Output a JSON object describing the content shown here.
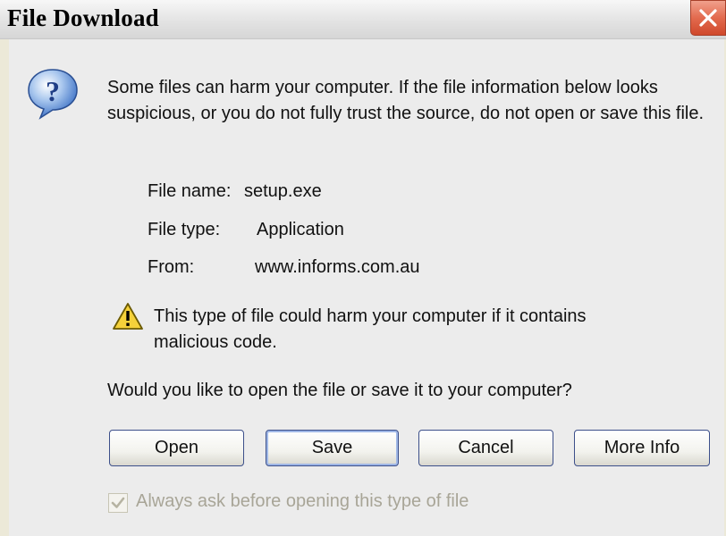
{
  "window": {
    "title": "File Download",
    "close_glyph": "✕"
  },
  "warning": {
    "text": "Some files can harm your computer. If the file information below looks suspicious, or you do not fully trust the source, do not open or save this file."
  },
  "file_info": {
    "name_label": "File name:",
    "name_value": "setup.exe",
    "type_label": "File type:",
    "type_value": "Application",
    "from_label": "From:",
    "from_value": "www.informs.com.au"
  },
  "harm_warning": {
    "text": "This type of file could harm your computer if it contains malicious code."
  },
  "question": "Would you like to open the file or save it to your computer?",
  "buttons": {
    "open": "Open",
    "save": "Save",
    "cancel": "Cancel",
    "more_info": "More Info"
  },
  "checkbox": {
    "label": "Always ask before opening this type of file",
    "checked": true,
    "disabled": true
  },
  "colors": {
    "dialog_bg": "#ececec",
    "close_button": "#e36a4e",
    "button_border": "#3c4f8a",
    "disabled_text": "#a8a597"
  }
}
